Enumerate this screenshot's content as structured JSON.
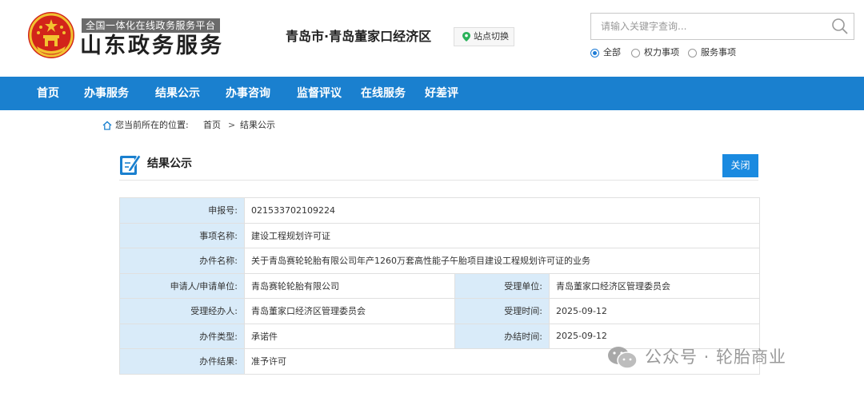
{
  "header": {
    "platform_tag": "全国一体化在线政务服务平台",
    "site_title": "山东政务服务",
    "region_name": "青岛市·青岛董家口经济区",
    "site_switch_label": "站点切换",
    "search_placeholder": "请输入关键字查询...",
    "search_scopes": [
      {
        "label": "全部",
        "selected": true
      },
      {
        "label": "权力事项",
        "selected": false
      },
      {
        "label": "服务事项",
        "selected": false
      }
    ]
  },
  "nav": {
    "items": [
      "首页",
      "办事服务",
      "结果公示",
      "办事咨询",
      "监督评议",
      "在线服务",
      "好差评"
    ]
  },
  "breadcrumb": {
    "prefix": "您当前所在的位置:",
    "items": [
      "首页",
      "结果公示"
    ],
    "separator": ">"
  },
  "panel": {
    "title": "结果公示",
    "close_label": "关闭"
  },
  "record": {
    "report_no_label": "申报号:",
    "report_no": "021533702109224",
    "item_name_label": "事项名称:",
    "item_name": "建设工程规划许可证",
    "case_name_label": "办件名称:",
    "case_name": "关于青岛赛轮轮胎有限公司年产1260万套高性能子午胎项目建设工程规划许可证的业务",
    "applicant_label": "申请人/申请单位:",
    "applicant": "青岛赛轮轮胎有限公司",
    "accepting_unit_label": "受理单位:",
    "accepting_unit": "青岛董家口经济区管理委员会",
    "handler_label": "受理经办人:",
    "handler": "青岛董家口经济区管理委员会",
    "accept_time_label": "受理时间:",
    "accept_time": "2025-09-12",
    "case_type_label": "办件类型:",
    "case_type": "承诺件",
    "finish_time_label": "办结时间:",
    "finish_time": "2025-09-12",
    "result_label": "办件结果:",
    "result": "准予许可"
  },
  "watermark": {
    "text": "公众号 · 轮胎商业"
  },
  "colors": {
    "nav_bg": "#1a80cf",
    "label_cell_bg": "#d9ebf9",
    "close_button_bg": "#1a8ae0",
    "emblem_red": "#d2241a",
    "emblem_gold": "#f2c230"
  },
  "icons": [
    "national-emblem-icon",
    "location-pin-icon",
    "search-icon",
    "home-icon",
    "edit-document-icon",
    "wechat-logo-icon"
  ]
}
